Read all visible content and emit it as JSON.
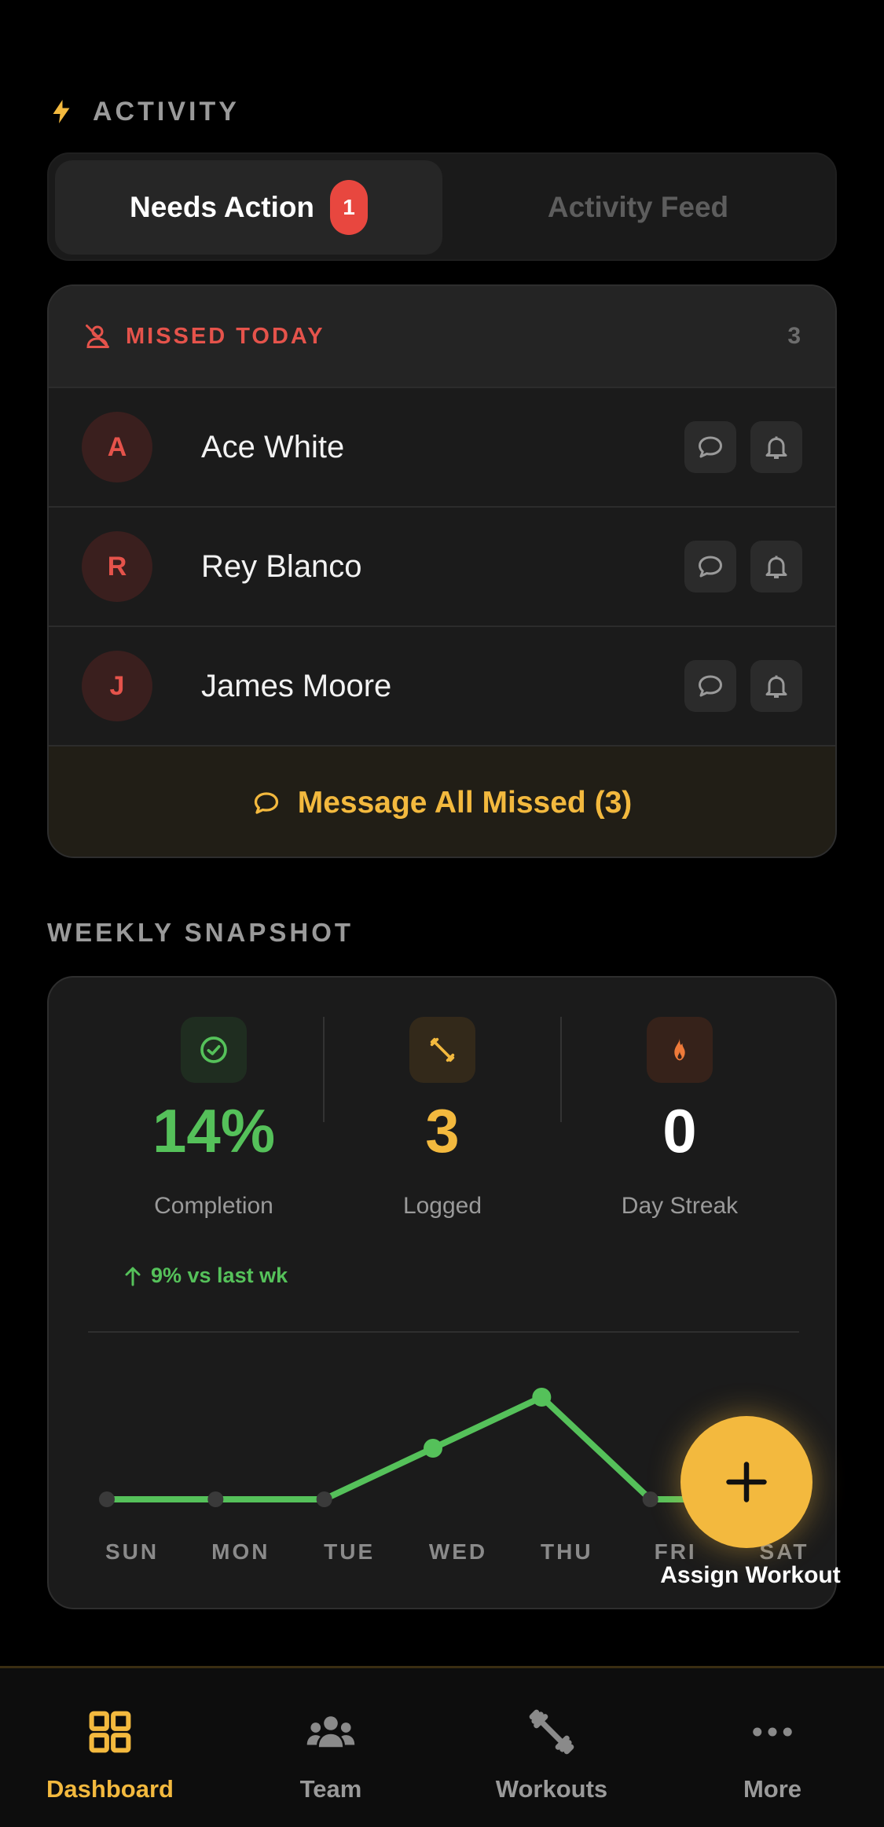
{
  "activity": {
    "section_title": "ACTIVITY",
    "tabs": [
      {
        "label": "Needs Action",
        "badge": "1",
        "active": true
      },
      {
        "label": "Activity Feed",
        "active": false
      }
    ]
  },
  "missed": {
    "title": "MISSED TODAY",
    "count": "3",
    "people": [
      {
        "initial": "A",
        "name": "Ace White"
      },
      {
        "initial": "R",
        "name": "Rey Blanco"
      },
      {
        "initial": "J",
        "name": "James Moore"
      }
    ],
    "message_all_label": "Message All Missed (3)"
  },
  "snapshot": {
    "section_title": "WEEKLY SNAPSHOT",
    "stats": [
      {
        "value": "14%",
        "label": "Completion",
        "color": "#55c15a",
        "icon": "check-circle-icon"
      },
      {
        "value": "3",
        "label": "Logged",
        "color": "#f3b93e",
        "icon": "dumbbell-icon"
      },
      {
        "value": "0",
        "label": "Day Streak",
        "color": "#ffffff",
        "icon": "flame-icon"
      }
    ],
    "trend": "9% vs last wk"
  },
  "chart_data": {
    "type": "line",
    "categories": [
      "SUN",
      "MON",
      "TUE",
      "WED",
      "THU",
      "FRI",
      "SAT"
    ],
    "series": [
      {
        "values": [
          0,
          0,
          0,
          1,
          2,
          0,
          0
        ]
      }
    ],
    "highlight_category": "SAT",
    "colors": {
      "line": "#55c15a",
      "inactive_point": "#3a3a3a",
      "highlight_label": "#f3b93e"
    }
  },
  "fab": {
    "label": "Assign Workout",
    "icon": "plus-icon"
  },
  "bottom_nav": {
    "items": [
      {
        "label": "Dashboard",
        "icon": "grid-icon",
        "active": true
      },
      {
        "label": "Team",
        "icon": "team-icon",
        "active": false
      },
      {
        "label": "Workouts",
        "icon": "dumbbell-icon",
        "active": false
      },
      {
        "label": "More",
        "icon": "more-icon",
        "active": false
      }
    ]
  },
  "colors": {
    "accent": "#f3b93e",
    "danger": "#e5534b",
    "success": "#55c15a",
    "background": "#000000"
  }
}
